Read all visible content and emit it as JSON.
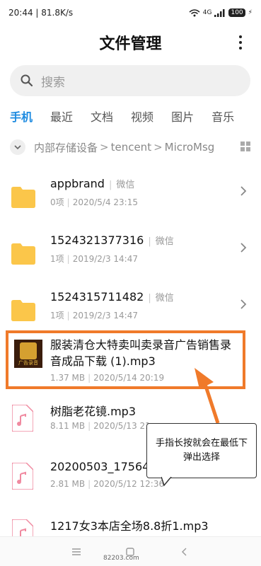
{
  "status_bar": {
    "time": "20:44",
    "speed": "81.8K/s",
    "network": "4G",
    "battery": "100"
  },
  "title": "文件管理",
  "search": {
    "placeholder": "搜索"
  },
  "tabs": [
    "手机",
    "最近",
    "文档",
    "视频",
    "图片",
    "音乐"
  ],
  "active_tab": "手机",
  "breadcrumb": [
    "内部存储设备",
    "tencent",
    "MicroMsg"
  ],
  "files": [
    {
      "name": "appbrand",
      "tag": "微信",
      "meta1": "0项",
      "meta2": "2020/5/4 23:15",
      "type": "folder"
    },
    {
      "name": "1524321377316",
      "tag": "微信",
      "meta1": "1项",
      "meta2": "2019/2/3 14:47",
      "type": "folder"
    },
    {
      "name": "1524315711482",
      "tag": "微信",
      "meta1": "1项",
      "meta2": "2019/2/3 14:47",
      "type": "folder"
    },
    {
      "name": "服装清仓大特卖叫卖录音广告销售录音成品下载 (1).mp3",
      "meta1": "1.37 MB",
      "meta2": "2020/5/14 20:19",
      "type": "audio-thumb",
      "thumb_text": "广告录音"
    },
    {
      "name": "树脂老花镜.mp3",
      "meta1": "8.11 MB",
      "meta2": "2020/5/13 21",
      "type": "audio"
    },
    {
      "name": "20200503_17564",
      "meta1": "2.81 MB",
      "meta2": "2020/5/12 12:36",
      "type": "audio"
    },
    {
      "name": "1217女3本店全场8.8折1.mp3",
      "type": "audio"
    }
  ],
  "annotation": "手指长按就会在最低下弹出选择",
  "watermark": "82203.com",
  "colors": {
    "accent": "#1e8be0",
    "folder": "#fbc64a",
    "highlight": "#f07a2a",
    "music": "#f08aa0"
  }
}
